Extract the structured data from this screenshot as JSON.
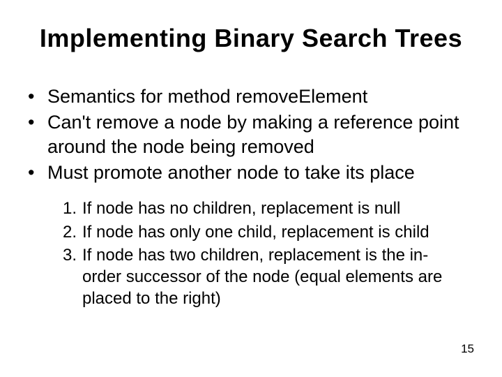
{
  "title": "Implementing Binary Search Trees",
  "bullets": [
    "Semantics for method removeElement",
    "Can't remove a node by making a reference point around the node being removed",
    "Must promote another node to take its place"
  ],
  "numbered": [
    "If node has no children, replacement is null",
    "If node has only one child, replacement is child",
    "If node has two children, replacement is the in-order successor of the node (equal elements are placed to the right)"
  ],
  "page_number": "15"
}
